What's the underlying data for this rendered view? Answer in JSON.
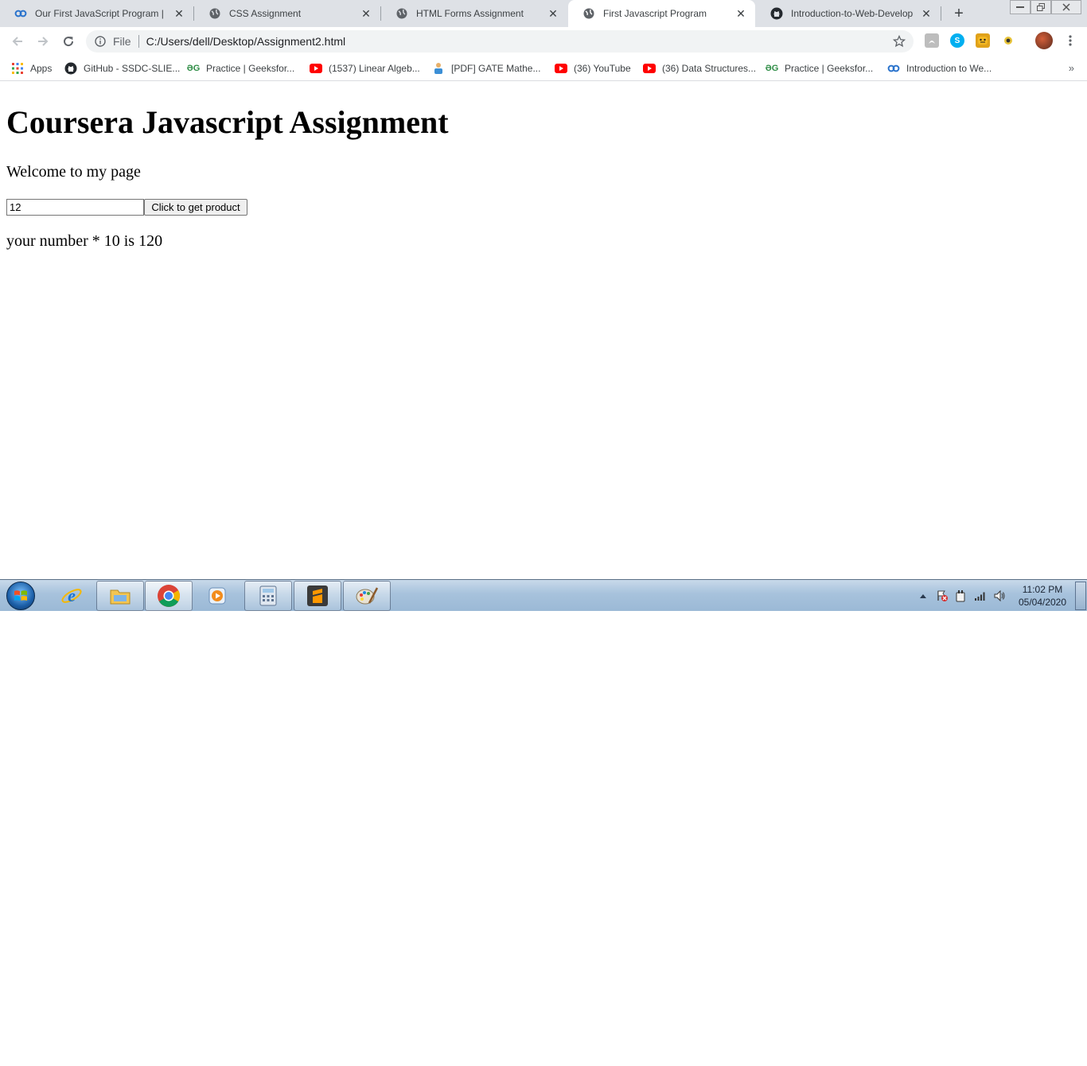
{
  "browser": {
    "tabs": [
      {
        "title": "Our First JavaScript Program | Co",
        "icon": "coursera-icon",
        "active": false
      },
      {
        "title": "CSS Assignment",
        "icon": "globe-icon",
        "active": false
      },
      {
        "title": "HTML Forms Assignment",
        "icon": "globe-icon",
        "active": false
      },
      {
        "title": "First Javascript Program",
        "icon": "globe-icon",
        "active": true
      },
      {
        "title": "Introduction-to-Web-Developm",
        "icon": "github-icon",
        "active": false
      }
    ],
    "close_glyph": "✕",
    "new_tab_glyph": "+",
    "address": {
      "scheme": "File",
      "url": "C:/Users/dell/Desktop/Assignment2.html"
    },
    "bookmarks": [
      {
        "label": "Apps",
        "icon": "apps-grid-icon"
      },
      {
        "label": "GitHub - SSDC-SLIE...",
        "icon": "github-icon"
      },
      {
        "label": "Practice | Geeksfor...",
        "icon": "geeksforgeeks-icon"
      },
      {
        "label": "(1537) Linear Algeb...",
        "icon": "youtube-icon"
      },
      {
        "label": "[PDF] GATE Mathe...",
        "icon": "person-icon"
      },
      {
        "label": "(36) YouTube",
        "icon": "youtube-icon"
      },
      {
        "label": "(36) Data Structures...",
        "icon": "youtube-icon"
      },
      {
        "label": "Practice | Geeksfor...",
        "icon": "geeksforgeeks-icon"
      },
      {
        "label": "Introduction to We...",
        "icon": "coursera-icon"
      }
    ],
    "bookmarks_more": "»"
  },
  "page": {
    "heading": "Coursera Javascript Assignment",
    "welcome": "Welcome to my page",
    "number_input_value": "12",
    "button_label": "Click to get product",
    "result_text": "your number * 10 is 120"
  },
  "taskbar": {
    "time": "11:02 PM",
    "date": "05/04/2020",
    "apps": [
      "internet-explorer-icon",
      "file-explorer-icon",
      "chrome-icon",
      "media-player-icon",
      "calculator-icon",
      "sublime-text-icon",
      "paint-icon"
    ]
  },
  "colors": {
    "tabstrip": "#dee1e6",
    "taskbar": "#a7c2dc",
    "youtube_red": "#ff0000",
    "gfg_green": "#2f8d46",
    "coursera_blue": "#2a73cc"
  }
}
